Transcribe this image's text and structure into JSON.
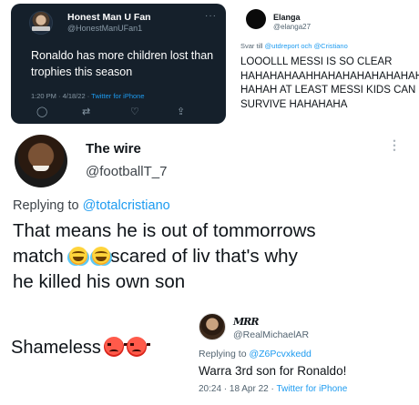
{
  "tweet_dark": {
    "name": "Honest Man U Fan",
    "handle": "@HonestManUFan1",
    "more": "···",
    "text": "Ronaldo has more children lost than trophies this season",
    "time": "1:20 PM · 4/18/22 · ",
    "source": "Twitter for iPhone",
    "actions": {
      "reply": "◯",
      "retweet": "⇄",
      "like": "♡",
      "share": "⇪"
    }
  },
  "tweet_elanga": {
    "name": "Elanga",
    "handle": "@elanga27",
    "reply_prefix": "Svar till ",
    "reply_to": "@utdreport och @Cristiano",
    "text": "LOOOLLL MESSI IS SO CLEAR\nHAHAHAHAAHHAHAHAHAHAHAHAH\nHAHAH AT LEAST MESSI KIDS CAN\nSURVIVE HAHAHAHA"
  },
  "tweet_main": {
    "name": "The wire",
    "handle": "@footballT_7",
    "reply_prefix": "Replying to ",
    "reply_to": "@totalcristiano",
    "text_line1": "That means he is out of tommorrows",
    "text_line2_start": "match ",
    "text_line2_end": "scared of liv that's why",
    "text_line3": "he killed his own son"
  },
  "comment": {
    "text": "Shameless"
  },
  "tweet_reply": {
    "signature": "MRR",
    "handle": "@RealMichaelAR",
    "reply_prefix": "Replying to ",
    "reply_to": "@Z6Pcvxkedd",
    "text": "Warra 3rd son for Ronaldo!",
    "time": "20:24 · 18 Apr 22 · ",
    "source": "Twitter for iPhone"
  },
  "colors": {
    "dark_bg": "#15202b",
    "link_blue": "#1d9bf0",
    "muted_gray": "#536471"
  }
}
